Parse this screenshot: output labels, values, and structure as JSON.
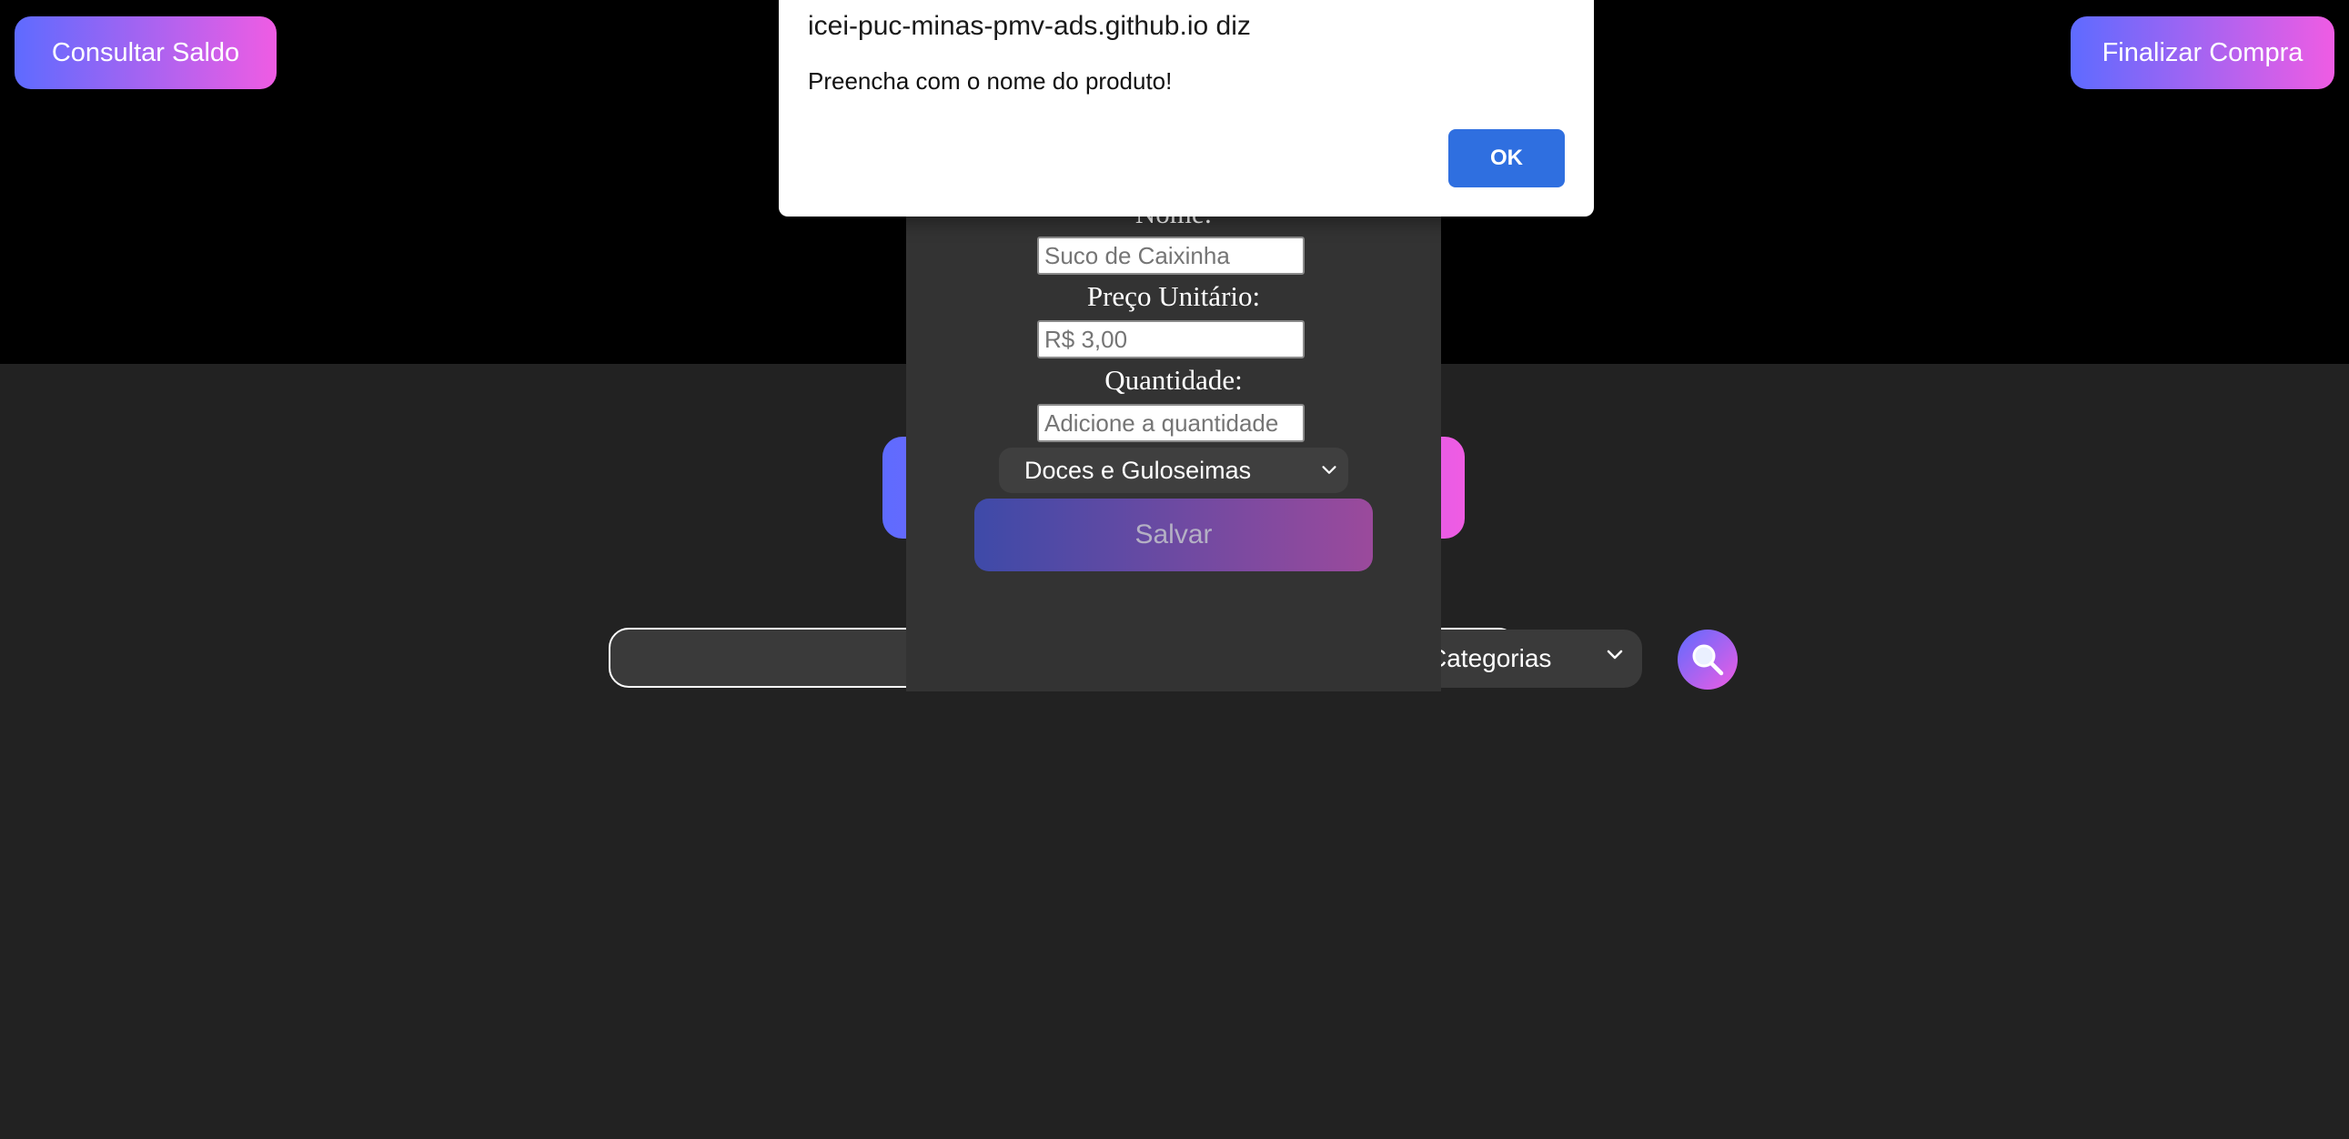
{
  "header": {
    "left_button": "Consultar Saldo",
    "right_button": "Finalizar Compra"
  },
  "search": {
    "query": "",
    "category": "Categorias"
  },
  "product_form": {
    "name_label": "Nome:",
    "name_placeholder": "Suco de Caixinha",
    "price_label": "Preço Unitário:",
    "price_placeholder": "R$ 3,00",
    "quantity_label": "Quantidade:",
    "quantity_placeholder": "Adicione a quantidade",
    "category_selected": "Doces e Guloseimas",
    "save_label": "Salvar"
  },
  "alert": {
    "origin": "icei-puc-minas-pmv-ads.github.io diz",
    "message": "Preencha com o nome do produto!",
    "ok_label": "OK"
  },
  "colors": {
    "gradient_start": "#5e6bff",
    "gradient_end": "#ef5ce3",
    "page_bg": "#222222",
    "header_bg": "#000000",
    "alert_button": "#2f6fe0"
  },
  "icons": {
    "search": "magnifier-icon",
    "dropdown": "chevron-down-icon"
  }
}
